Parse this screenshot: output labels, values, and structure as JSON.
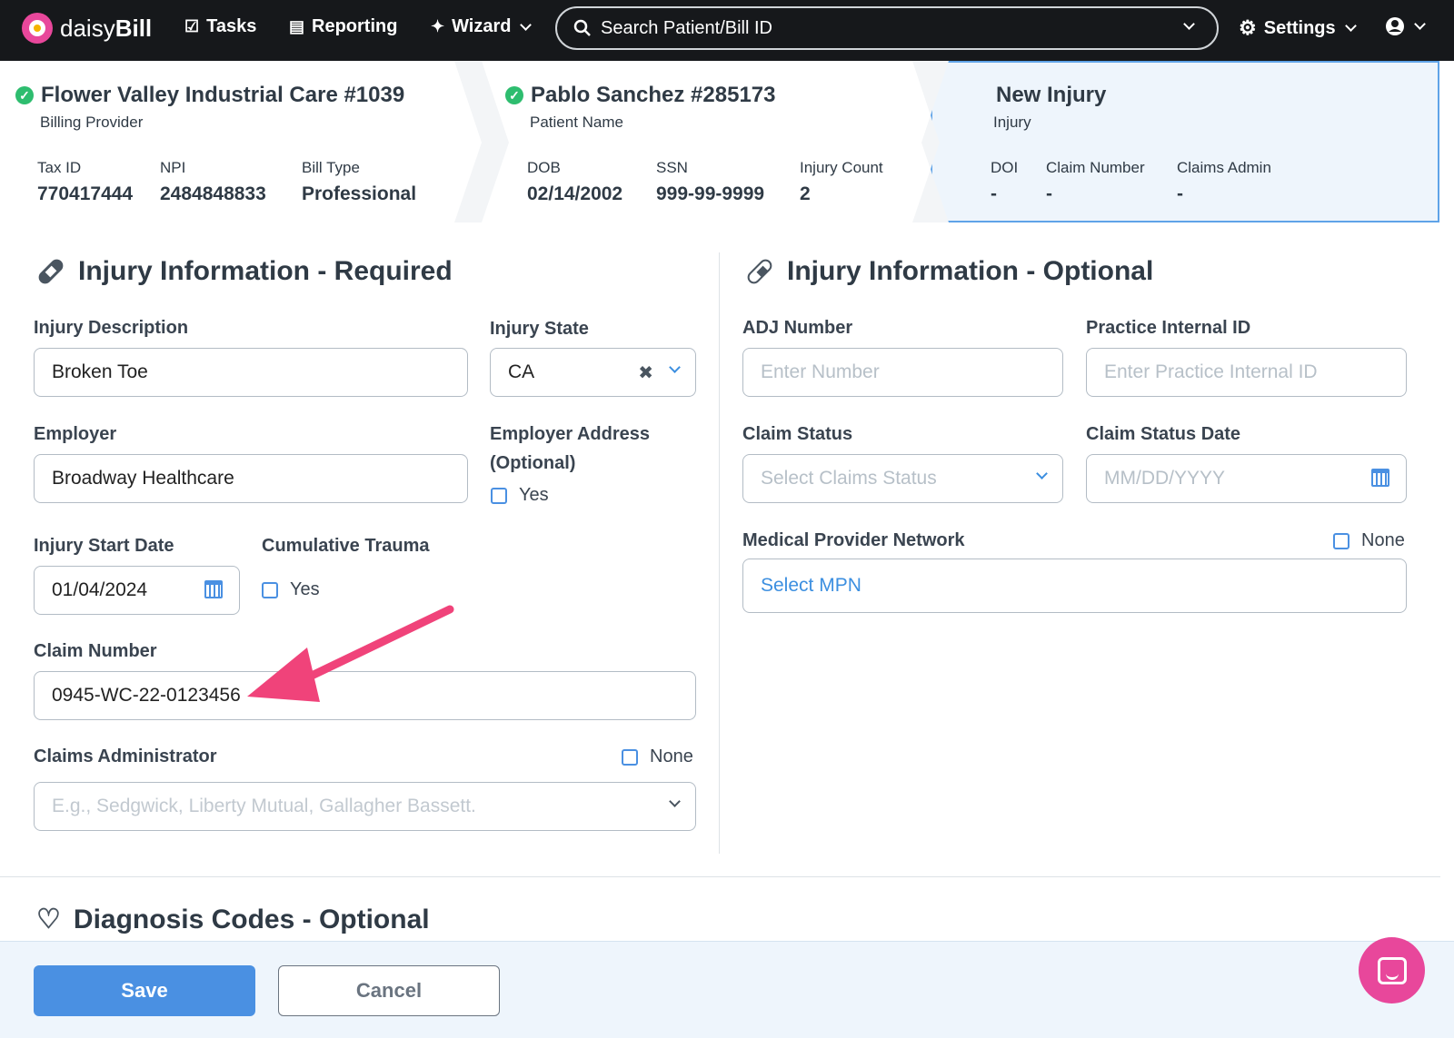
{
  "brand": {
    "name_light": "daisy",
    "name_bold": "Bill"
  },
  "nav": {
    "tasks": "Tasks",
    "reporting": "Reporting",
    "wizard": "Wizard",
    "settings": "Settings"
  },
  "search": {
    "placeholder": "Search Patient/Bill ID"
  },
  "provider": {
    "title": "Flower Valley Industrial Care #1039",
    "subtitle": "Billing Provider",
    "tax_id_label": "Tax ID",
    "tax_id": "770417444",
    "npi_label": "NPI",
    "npi": "2484848833",
    "bill_type_label": "Bill Type",
    "bill_type": "Professional"
  },
  "patient": {
    "title": "Pablo Sanchez #285173",
    "subtitle": "Patient Name",
    "dob_label": "DOB",
    "dob": "02/14/2002",
    "ssn_label": "SSN",
    "ssn": "999-99-9999",
    "injury_count_label": "Injury Count",
    "injury_count": "2"
  },
  "injury_header": {
    "title": "New Injury",
    "subtitle": "Injury",
    "doi_label": "DOI",
    "doi": "-",
    "claim_number_label": "Claim Number",
    "claim_number": "-",
    "claims_admin_label": "Claims Admin",
    "claims_admin": "-"
  },
  "required": {
    "title": "Injury Information - Required",
    "injury_description_label": "Injury Description",
    "injury_description": "Broken Toe",
    "injury_state_label": "Injury State",
    "injury_state": "CA",
    "employer_label": "Employer",
    "employer": "Broadway Healthcare",
    "employer_address_label_1": "Employer Address",
    "employer_address_label_2": "(Optional)",
    "employer_address_yes": "Yes",
    "injury_start_date_label": "Injury Start Date",
    "injury_start_date": "01/04/2024",
    "cumulative_trauma_label": "Cumulative Trauma",
    "cumulative_trauma_yes": "Yes",
    "claim_number_label": "Claim Number",
    "claim_number": "0945-WC-22-0123456",
    "claims_admin_label": "Claims Administrator",
    "claims_admin_none": "None",
    "claims_admin_placeholder": "E.g., Sedgwick, Liberty Mutual, Gallagher Bassett."
  },
  "optional": {
    "title": "Injury Information - Optional",
    "adj_label": "ADJ Number",
    "adj_placeholder": "Enter Number",
    "practice_id_label": "Practice Internal ID",
    "practice_id_placeholder": "Enter Practice Internal ID",
    "claim_status_label": "Claim Status",
    "claim_status_placeholder": "Select Claims Status",
    "claim_status_date_label": "Claim Status Date",
    "claim_status_date_placeholder": "MM/DD/YYYY",
    "mpn_label": "Medical Provider Network",
    "mpn_none": "None",
    "mpn_select": "Select MPN"
  },
  "diagnosis": {
    "title": "Diagnosis Codes - Optional"
  },
  "footer": {
    "save": "Save",
    "cancel": "Cancel"
  },
  "colors": {
    "accent": "#4a90e2",
    "brand_pink": "#e8479b",
    "success": "#2ebd6f",
    "topbar": "#16181b"
  }
}
